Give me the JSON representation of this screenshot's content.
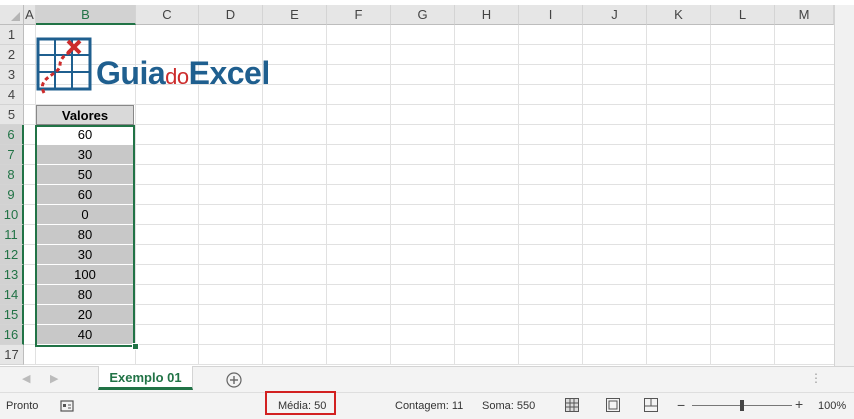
{
  "columns": [
    "A",
    "B",
    "C",
    "D",
    "E",
    "F",
    "G",
    "H",
    "I",
    "J",
    "K",
    "L",
    "M"
  ],
  "rows": [
    "1",
    "2",
    "3",
    "4",
    "5",
    "6",
    "7",
    "8",
    "9",
    "10",
    "11",
    "12",
    "13",
    "14",
    "15",
    "16",
    "17"
  ],
  "logo": {
    "text_guia": "Guia",
    "text_do": "do",
    "text_excel": "Excel"
  },
  "table": {
    "header": "Valores",
    "values": [
      "60",
      "30",
      "50",
      "60",
      "0",
      "80",
      "30",
      "100",
      "80",
      "20",
      "40"
    ]
  },
  "sheet": {
    "tab_label": "Exemplo 01"
  },
  "status": {
    "ready": "Pronto",
    "average": "Média: 50",
    "count": "Contagem: 11",
    "sum": "Soma: 550",
    "zoom": "100%",
    "zoom_level_fraction": 0.5
  },
  "colors": {
    "accent": "#217346",
    "logo_blue": "#1f5f8f",
    "logo_red": "#cc2c2c",
    "highlight_red": "#d22020"
  },
  "icons": [
    "macro-record-icon",
    "add-sheet-icon",
    "normal-view-icon",
    "page-layout-icon",
    "page-break-icon",
    "zoom-out-icon",
    "zoom-in-icon",
    "tab-scroll-left-icon",
    "tab-scroll-right-icon",
    "tab-options-icon"
  ]
}
